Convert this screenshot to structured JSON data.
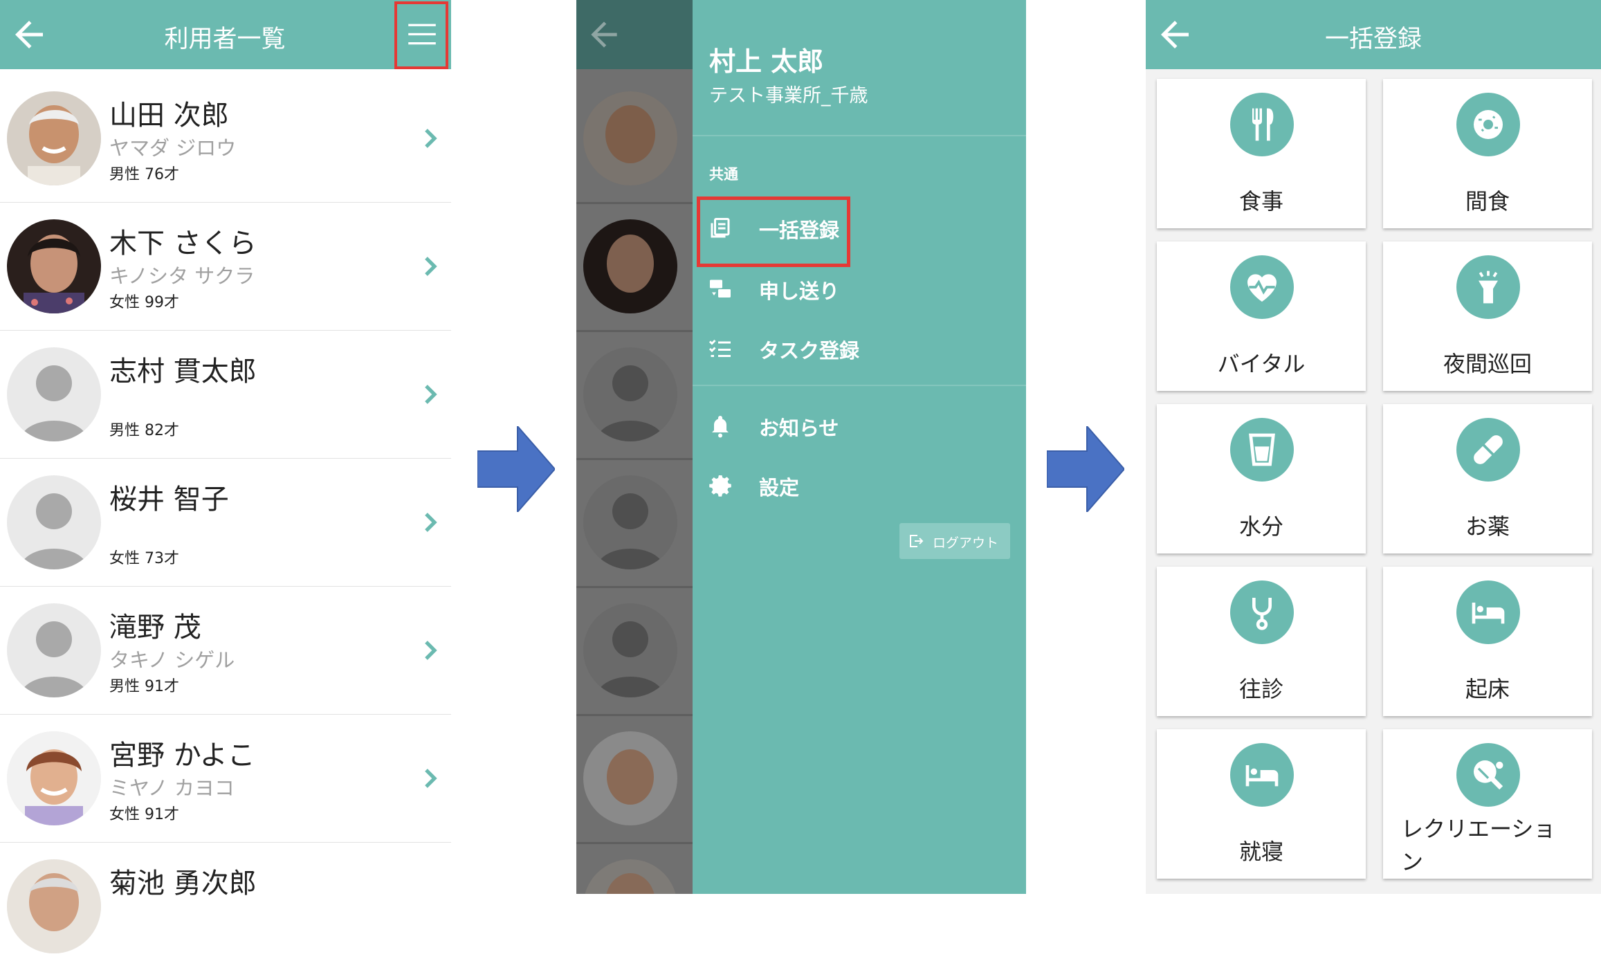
{
  "panel1": {
    "title": "利用者一覧",
    "residents": [
      {
        "name": "山田 次郎",
        "kana": "ヤマダ ジロウ",
        "info": "男性 76才",
        "photo": "elderly-man-photo"
      },
      {
        "name": "木下 さくら",
        "kana": "キノシタ サクラ",
        "info": "女性 99才",
        "photo": "elderly-woman-photo"
      },
      {
        "name": "志村 貫太郎",
        "kana": "",
        "info": "男性 82才",
        "photo": "placeholder-avatar"
      },
      {
        "name": "桜井 智子",
        "kana": "",
        "info": "女性 73才",
        "photo": "placeholder-avatar"
      },
      {
        "name": "滝野 茂",
        "kana": "タキノ シゲル",
        "info": "男性 91才",
        "photo": "placeholder-avatar"
      },
      {
        "name": "宮野 かよこ",
        "kana": "ミヤノ カヨコ",
        "info": "女性 91才",
        "photo": "smiling-woman-photo"
      },
      {
        "name": "菊池 勇次郎",
        "kana": "",
        "info": "",
        "photo": "elderly-man-photo"
      }
    ]
  },
  "panel2": {
    "user_name": "村上 太郎",
    "office": "テスト事業所_千歳",
    "section": "共通",
    "items": [
      {
        "label": "一括登録",
        "icon": "bulk-register-icon"
      },
      {
        "label": "申し送り",
        "icon": "handover-icon"
      },
      {
        "label": "タスク登録",
        "icon": "task-list-icon"
      },
      {
        "label": "お知らせ",
        "icon": "bell-icon"
      },
      {
        "label": "設定",
        "icon": "gear-icon"
      }
    ],
    "logout": "ログアウト"
  },
  "panel3": {
    "title": "一括登録",
    "tiles": [
      {
        "label": "食事",
        "icon": "meal-icon"
      },
      {
        "label": "間食",
        "icon": "donut-icon"
      },
      {
        "label": "バイタル",
        "icon": "vital-heart-icon"
      },
      {
        "label": "夜間巡回",
        "icon": "flashlight-icon"
      },
      {
        "label": "水分",
        "icon": "water-cup-icon"
      },
      {
        "label": "お薬",
        "icon": "capsule-icon"
      },
      {
        "label": "往診",
        "icon": "stethoscope-icon"
      },
      {
        "label": "起床",
        "icon": "bed-icon"
      },
      {
        "label": "就寝",
        "icon": "bed-icon"
      },
      {
        "label": "レクリエーション",
        "icon": "ping-pong-icon"
      }
    ]
  },
  "colors": {
    "primary": "#6bbab0",
    "highlight": "#e53935",
    "arrow": "#4a72c4"
  }
}
